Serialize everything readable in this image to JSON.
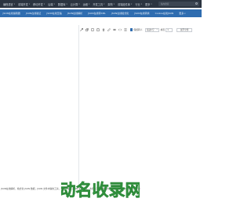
{
  "top_nav": {
    "items": [
      "编程语言",
      "前端开发",
      "移动开发",
      "后端",
      "数据库",
      "云计算",
      "运维",
      "开发工具",
      "架构",
      "前端组件库",
      "行业",
      "更多"
    ],
    "search_placeholder": "站内搜索"
  },
  "sub_nav": {
    "tabs": [
      "JSON在线编辑器",
      "JSON在线验证",
      "JSON在线压缩",
      "JSON在线解析",
      "JSON在线转XML",
      "JSON在线格式化",
      "JSON在线转换",
      "Cookie在线JSON"
    ],
    "more_label": "更多"
  },
  "toolbar": {
    "checkbox_label": "保留转义",
    "indent_select": "缩进2空",
    "count_label": "换页",
    "count_value": "1",
    "action_label": "展开全部"
  },
  "footer_text": "JSON在线解析，格式化 JSON 数据，JSON 文件内容的工具，查看、编辑 JSON 文件代码，支持以不同层级的方式查看，为 JSON 代码提供便捷",
  "watermark": {
    "text": "动名收录网",
    "colors": [
      "#2e8b3a",
      "#3fae4f",
      "#f08a24"
    ]
  },
  "colors": {
    "top_nav_bg": "#2b3440",
    "sub_nav_bg": "#2f6db0",
    "accent": "#2f6db0"
  }
}
